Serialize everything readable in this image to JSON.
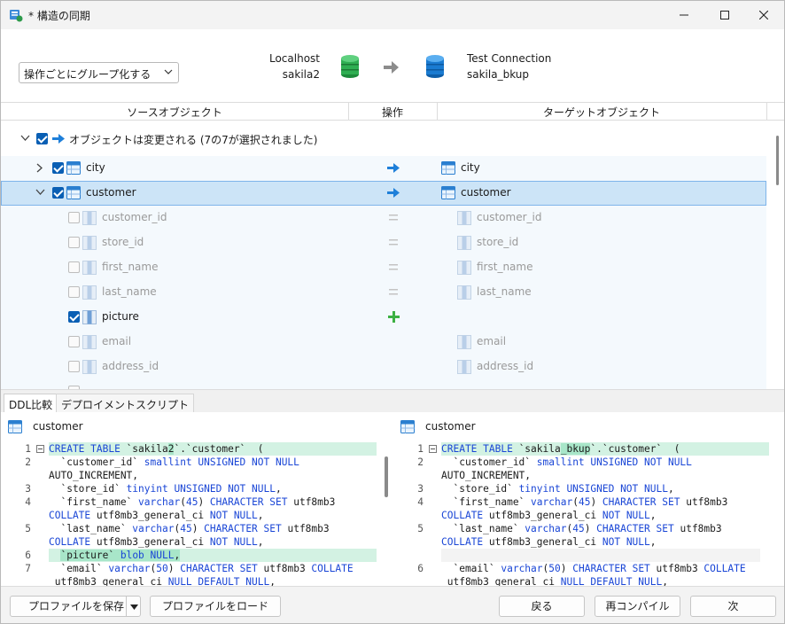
{
  "window": {
    "title": "* 構造の同期"
  },
  "top": {
    "group_mode": "操作ごとにグループ化する",
    "source": {
      "connection": "Localhost",
      "database": "sakila2"
    },
    "target": {
      "connection": "Test Connection",
      "database": "sakila_bkup"
    }
  },
  "columns": {
    "source": "ソースオブジェクト",
    "action": "操作",
    "target": "ターゲットオブジェクト"
  },
  "tree": {
    "group_label": "オブジェクトは変更される (7の7が選択されました)",
    "tables": [
      {
        "name": "city",
        "target": "city"
      },
      {
        "name": "customer",
        "target": "customer"
      }
    ],
    "fields": [
      {
        "name": "customer_id",
        "target": "customer_id"
      },
      {
        "name": "store_id",
        "target": "store_id"
      },
      {
        "name": "first_name",
        "target": "first_name"
      },
      {
        "name": "last_name",
        "target": "last_name"
      },
      {
        "name": "picture",
        "target": ""
      },
      {
        "name": "email",
        "target": "email"
      },
      {
        "name": "address_id",
        "target": "address_id"
      }
    ]
  },
  "tabs": {
    "ddl": "DDL比較",
    "deploy": "デプロイメントスクリプト"
  },
  "ddl": {
    "left_title": "customer",
    "right_title": "customer",
    "left_numbers": [
      "1",
      "2",
      "3",
      "4",
      "5",
      "6",
      "7"
    ],
    "right_numbers": [
      "1",
      "2",
      "3",
      "4",
      "5",
      "6"
    ]
  },
  "footer": {
    "save_profile": "プロファイルを保存",
    "load_profile": "プロファイルをロード",
    "back": "戻る",
    "recompile": "再コンパイル",
    "next": "次"
  },
  "colors": {
    "accent": "#0a5fb4",
    "selected": "#cce4f7",
    "diff_green": "#d3f2e3"
  }
}
